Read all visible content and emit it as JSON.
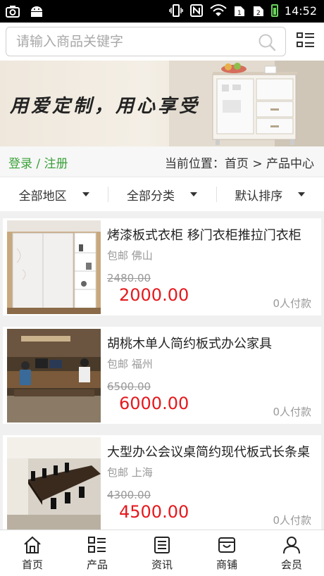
{
  "status": {
    "time": "14:52"
  },
  "search": {
    "placeholder": "请输入商品关键字"
  },
  "banner": {
    "slogan": "用爱定制，用心享受"
  },
  "crumbbar": {
    "login": "登录 / 注册",
    "location": "当前位置：首页 > 产品中心"
  },
  "filters": [
    {
      "label": "全部地区"
    },
    {
      "label": "全部分类"
    },
    {
      "label": "默认排序"
    }
  ],
  "products": [
    {
      "title": "烤漆板式衣柜 移门衣柜推拉门衣柜",
      "shipping": "包邮 佛山",
      "original_price": "2480.00",
      "price": "2000.00",
      "sold": "0人付款"
    },
    {
      "title": "胡桃木单人简约板式办公家具",
      "shipping": "包邮 福州",
      "original_price": "6500.00",
      "price": "6000.00",
      "sold": "0人付款"
    },
    {
      "title": "大型办公会议桌简约现代板式长条桌",
      "shipping": "包邮 上海",
      "original_price": "4300.00",
      "price": "4500.00",
      "sold": "0人付款"
    }
  ],
  "tabbar": [
    {
      "label": "首页",
      "icon": "home-icon"
    },
    {
      "label": "产品",
      "icon": "list-icon"
    },
    {
      "label": "资讯",
      "icon": "news-icon"
    },
    {
      "label": "商铺",
      "icon": "store-icon"
    },
    {
      "label": "会员",
      "icon": "user-icon"
    }
  ],
  "colors": {
    "accent_green": "#3aa13a",
    "price_red": "#e5181c"
  }
}
